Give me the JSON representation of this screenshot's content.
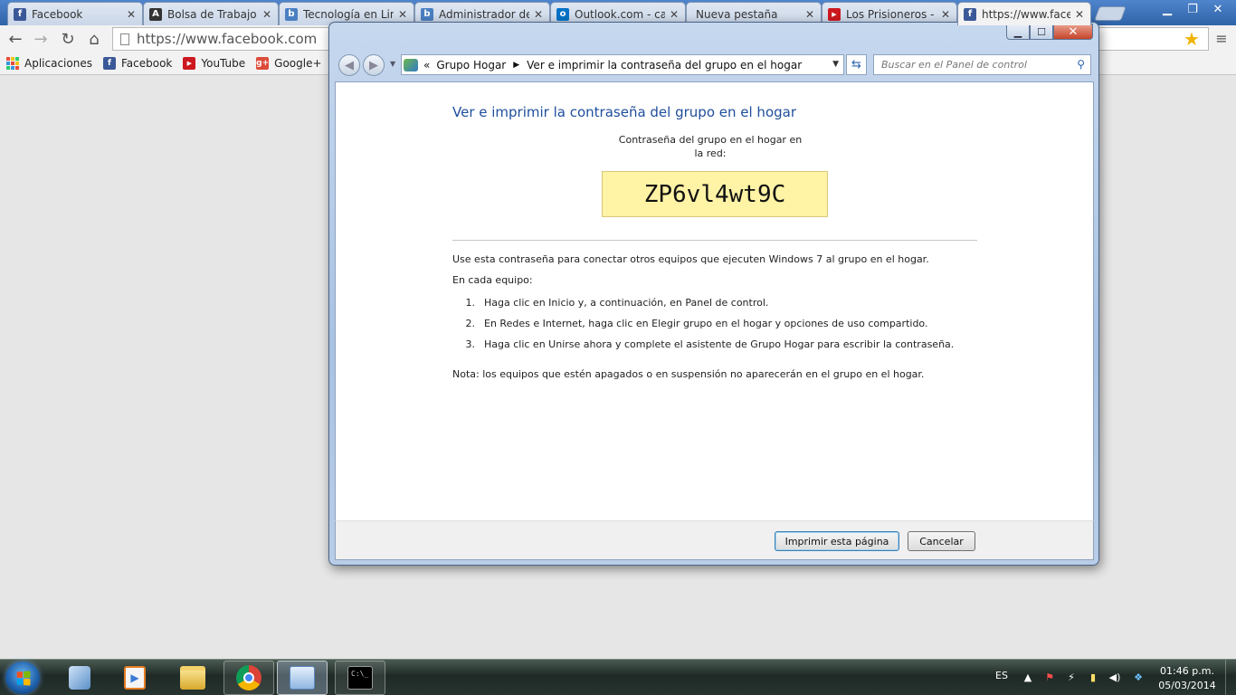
{
  "browser": {
    "tabs": [
      {
        "title": "Facebook",
        "icon": "facebook-icon",
        "color": "#3b5998",
        "glyph": "f",
        "active": false
      },
      {
        "title": "Bolsa de Trabajo |",
        "icon": "bolsa-trabajo-icon",
        "color": "#333333",
        "glyph": "A",
        "active": false
      },
      {
        "title": "Tecnología en Lin",
        "icon": "blog-b-icon",
        "color": "#4a7fc1",
        "glyph": "b",
        "active": false
      },
      {
        "title": "Administrador de",
        "icon": "blog-b-icon",
        "color": "#4a7fc1",
        "glyph": "b",
        "active": false
      },
      {
        "title": "Outlook.com - ca",
        "icon": "outlook-icon",
        "color": "#0072c6",
        "glyph": "o",
        "active": false
      },
      {
        "title": "Nueva pestaña",
        "icon": "",
        "color": "",
        "glyph": "",
        "active": false
      },
      {
        "title": "Los Prisioneros - E",
        "icon": "youtube-icon",
        "color": "#cc181e",
        "glyph": "▶",
        "active": false
      },
      {
        "title": "https://www.facel",
        "icon": "facebook-icon",
        "color": "#3b5998",
        "glyph": "f",
        "active": true
      }
    ],
    "url": "https://www.facebook.com",
    "bookmarks": [
      {
        "label": "Aplicaciones",
        "icon": "apps-grid-icon"
      },
      {
        "label": "Facebook",
        "icon": "facebook-icon",
        "color": "#3b5998",
        "glyph": "f"
      },
      {
        "label": "YouTube",
        "icon": "youtube-icon",
        "color": "#cc181e",
        "glyph": "▶"
      },
      {
        "label": "Google+",
        "icon": "google-plus-icon",
        "color": "#dd4b39",
        "glyph": "g+"
      },
      {
        "label": "",
        "icon": "gmail-icon",
        "color": "#d14836",
        "glyph": "M"
      }
    ]
  },
  "dialog": {
    "breadcrumb_root": "Grupo Hogar",
    "breadcrumb_current": "Ver e imprimir la contraseña del grupo en el hogar",
    "search_placeholder": "Buscar en el Panel de control",
    "title": "Ver e imprimir la contraseña del grupo en el hogar",
    "password_label": "Contraseña del grupo en el hogar en la red:",
    "password": "ZP6vl4wt9C",
    "intro": "Use esta contraseña para conectar otros equipos que ejecuten Windows 7 al grupo en el hogar.",
    "each_computer": "En cada equipo:",
    "steps": [
      {
        "num": "1.",
        "text": "Haga clic en Inicio y, a continuación, en Panel de control."
      },
      {
        "num": "2.",
        "text": "En Redes e Internet, haga clic en Elegir grupo en el hogar y opciones de uso compartido."
      },
      {
        "num": "3.",
        "text": "Haga clic en Unirse ahora y complete el asistente de Grupo Hogar para escribir la contraseña."
      }
    ],
    "note": "Nota: los equipos que estén apagados o en suspensión no aparecerán en el grupo en el hogar.",
    "print_button": "Imprimir esta página",
    "cancel_button": "Cancelar"
  },
  "taskbar": {
    "language": "ES",
    "time": "01:46 p.m.",
    "date": "05/03/2014",
    "apps": [
      "virtualbox-icon",
      "media-player-icon",
      "file-explorer-icon",
      "chrome-icon",
      "control-panel-icon",
      "command-prompt-icon"
    ]
  },
  "colors": {
    "titlebar_blue": "#3a6fb5",
    "link_blue": "#1e4e9c",
    "password_bg": "#fff3a5"
  }
}
